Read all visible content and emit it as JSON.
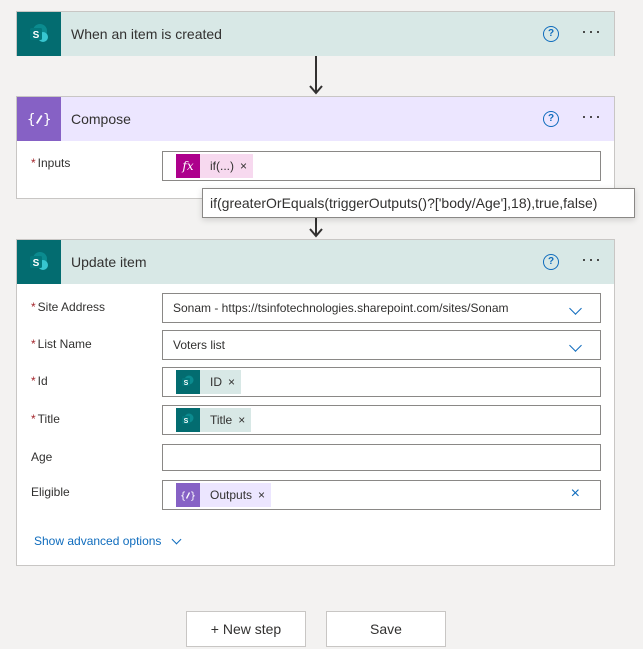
{
  "trigger": {
    "title": "When an item is created",
    "help": "?",
    "more": "···"
  },
  "compose": {
    "title": "Compose",
    "help": "?",
    "more": "···",
    "inputs_label": "Inputs",
    "token_label": "if(...)",
    "token_icon": "fx",
    "token_remove": "×"
  },
  "tooltip": {
    "text": "if(greaterOrEquals(triggerOutputs()?['body/Age'],18),true,false)"
  },
  "update": {
    "title": "Update item",
    "help": "?",
    "more": "···",
    "fields": {
      "site_address": {
        "label": "Site Address",
        "value": "Sonam - https://tsinfotechnologies.sharepoint.com/sites/Sonam"
      },
      "list_name": {
        "label": "List Name",
        "value": "Voters list"
      },
      "id": {
        "label": "Id",
        "token": "ID"
      },
      "title": {
        "label": "Title",
        "token": "Title"
      },
      "age": {
        "label": "Age",
        "value": ""
      },
      "eligible": {
        "label": "Eligible",
        "token": "Outputs"
      }
    },
    "token_remove": "×",
    "clear": "×",
    "required_mark": "*",
    "advanced": "Show advanced options"
  },
  "buttons": {
    "new_step": "+ New step",
    "save": "Save"
  },
  "colors": {
    "sharepoint": "#036c70",
    "compose": "#8661c5",
    "expression": "#ad008c",
    "link": "#0f6cbd"
  },
  "icons": {
    "sharepoint": "sharepoint-icon",
    "compose": "compose-icon",
    "expression": "fx-icon"
  }
}
